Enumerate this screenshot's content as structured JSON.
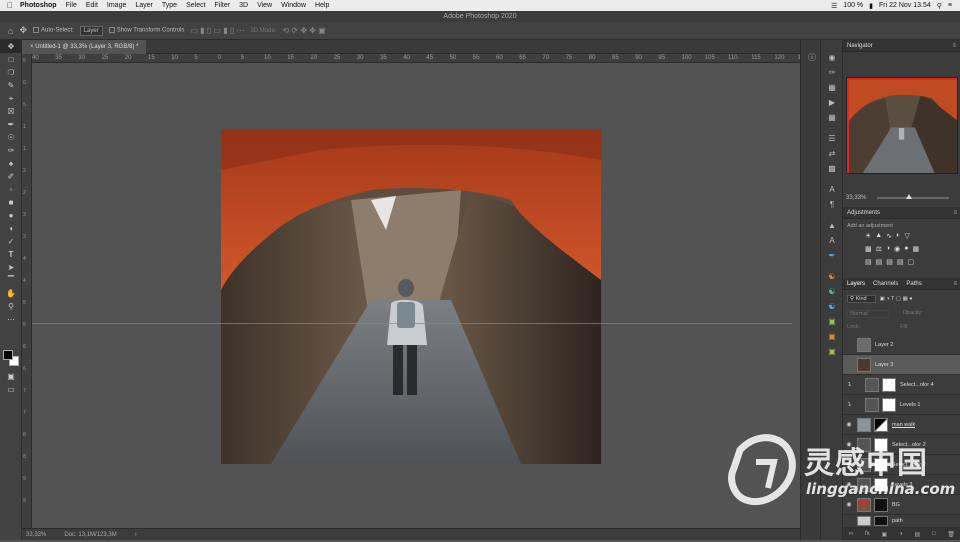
{
  "menubar": {
    "app_name": "Photoshop",
    "items": [
      "File",
      "Edit",
      "Image",
      "Layer",
      "Type",
      "Select",
      "Filter",
      "3D",
      "View",
      "Window",
      "Help"
    ],
    "battery": "100 %",
    "datetime": "Fri 22 Nov  13.54"
  },
  "window_title": "Adobe Photoshop 2020",
  "options_bar": {
    "auto_select_label": "Auto-Select:",
    "auto_select_value": "Layer",
    "transform_controls_label": "Show Transform Controls",
    "mode_label": "3D Mode:"
  },
  "document_tab": "Untitled-1 @ 33,3% (Layer 3, RGB/8) *",
  "ruler_h_ticks": [
    "40",
    "35",
    "30",
    "25",
    "20",
    "15",
    "10",
    "5",
    "0",
    "5",
    "10",
    "15",
    "20",
    "25",
    "30",
    "35",
    "40",
    "45",
    "50",
    "55",
    "60",
    "65",
    "70",
    "75",
    "80",
    "85",
    "90",
    "95",
    "100",
    "105",
    "110",
    "115",
    "120",
    "125"
  ],
  "ruler_v_ticks": [
    "5",
    "0",
    "5",
    "1",
    "1",
    "2",
    "2",
    "3",
    "3",
    "4",
    "4",
    "5",
    "5",
    "6",
    "6",
    "7",
    "7",
    "8",
    "8",
    "9",
    "9"
  ],
  "status": {
    "zoom": "33,33%",
    "doc": "Doc: 13,1M/123,3M"
  },
  "navigator": {
    "title": "Navigator",
    "zoom": "33,33%"
  },
  "adjustments": {
    "title": "Adjustments",
    "subtitle": "Add an adjustment"
  },
  "layers_panel": {
    "tabs": [
      "Layers",
      "Channels",
      "Paths"
    ],
    "filter_kind": "Kind",
    "blend_mode": "Normal",
    "opacity_label": "Opacity:",
    "lock_label": "Lock:",
    "fill_label": "Fill:",
    "layers": [
      {
        "name": "Layer 2",
        "selected": false
      },
      {
        "name": "Layer 3",
        "selected": true
      },
      {
        "name": "Select...olor 4",
        "selected": false
      },
      {
        "name": "Levels 1",
        "selected": false
      },
      {
        "name": "man walk",
        "selected": false
      },
      {
        "name": "Select...olor 2",
        "selected": false
      },
      {
        "name": "Select...olor 2",
        "selected": false
      },
      {
        "name": "Levels 3",
        "selected": false
      },
      {
        "name": "BG",
        "selected": false
      },
      {
        "name": "path",
        "selected": false
      }
    ]
  },
  "watermark": {
    "text_cn": "灵感中国",
    "text_en": "lingganchina.com"
  },
  "colors": {
    "guide": "#00b7e8",
    "panel_bg": "#3c3c3c",
    "canvas_bg": "#535353",
    "navigator_frame": "#e5261f"
  }
}
